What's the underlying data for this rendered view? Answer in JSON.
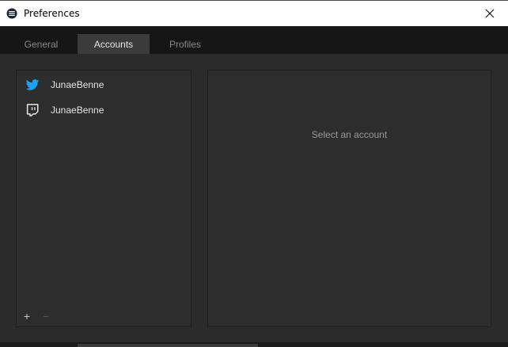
{
  "window": {
    "title": "Preferences",
    "close_icon": "close-icon",
    "app_icon": "app-icon"
  },
  "tabs": [
    {
      "label": "General",
      "active": false
    },
    {
      "label": "Accounts",
      "active": true
    },
    {
      "label": "Profiles",
      "active": false
    }
  ],
  "accounts": [
    {
      "service": "twitter",
      "icon": "twitter-icon",
      "name": "JunaeBenne"
    },
    {
      "service": "twitch",
      "icon": "twitch-icon",
      "name": "JunaeBenne"
    }
  ],
  "list_actions": {
    "add": "+",
    "remove": "−"
  },
  "detail": {
    "empty_message": "Select an account"
  },
  "colors": {
    "twitter": "#1da1f2",
    "background": "#2b2b2b",
    "tab_active": "#3b3b3b"
  }
}
